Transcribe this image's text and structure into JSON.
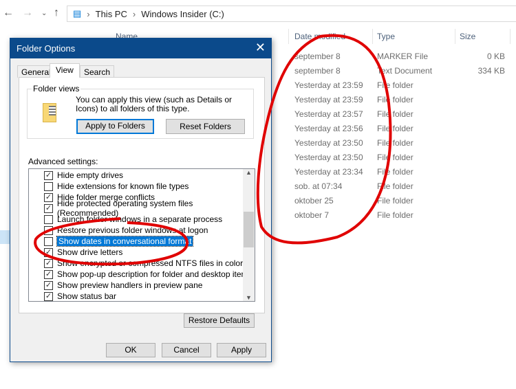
{
  "explorer": {
    "breadcrumb": [
      "This PC",
      "Windows Insider (C:)"
    ],
    "columns": [
      "Name",
      "Date modified",
      "Type",
      "Size"
    ],
    "rows": [
      {
        "date": "september 8",
        "type": "MARKER File",
        "size": "0 KB"
      },
      {
        "date": "september 8",
        "type": "Text Document",
        "size": "334 KB"
      },
      {
        "date": "Yesterday at 23:59",
        "type": "File folder",
        "size": ""
      },
      {
        "date": "Yesterday at 23:59",
        "type": "File folder",
        "size": ""
      },
      {
        "date": "Yesterday at 23:57",
        "type": "File folder",
        "size": ""
      },
      {
        "date": "Yesterday at 23:56",
        "type": "File folder",
        "size": ""
      },
      {
        "date": "Yesterday at 23:50",
        "type": "File folder",
        "size": ""
      },
      {
        "date": "Yesterday at 23:50",
        "type": "File folder",
        "size": ""
      },
      {
        "date": "Yesterday at 23:34",
        "type": "File folder",
        "size": ""
      },
      {
        "date": "sob. at 07:34",
        "type": "File folder",
        "size": ""
      },
      {
        "date": "oktober 25",
        "type": "File folder",
        "size": ""
      },
      {
        "date": "oktober 7",
        "type": "File folder",
        "size": ""
      }
    ]
  },
  "dialog": {
    "title": "Folder Options",
    "tabs": [
      "General",
      "View",
      "Search"
    ],
    "active_tab": "View",
    "folder_views_label": "Folder views",
    "folder_views_text": "You can apply this view (such as Details or Icons) to all folders of this type.",
    "apply_to_folders": "Apply to Folders",
    "reset_folders": "Reset Folders",
    "advanced_label": "Advanced settings:",
    "settings": [
      {
        "label": "Hide empty drives",
        "checked": true
      },
      {
        "label": "Hide extensions for known file types",
        "checked": false
      },
      {
        "label": "Hide folder merge conflicts",
        "checked": true
      },
      {
        "label": "Hide protected operating system files (Recommended)",
        "checked": true
      },
      {
        "label": "Launch folder windows in a separate process",
        "checked": false
      },
      {
        "label": "Restore previous folder windows at logon",
        "checked": false
      },
      {
        "label": "Show dates in conversational format",
        "checked": false,
        "selected": true
      },
      {
        "label": "Show drive letters",
        "checked": true
      },
      {
        "label": "Show encrypted or compressed NTFS files in color",
        "checked": true
      },
      {
        "label": "Show pop-up description for folder and desktop items",
        "checked": true
      },
      {
        "label": "Show preview handlers in preview pane",
        "checked": true
      },
      {
        "label": "Show status bar",
        "checked": true
      }
    ],
    "restore_defaults": "Restore Defaults",
    "ok": "OK",
    "cancel": "Cancel",
    "apply": "Apply"
  },
  "colors": {
    "title_bar": "#0b4a8b",
    "selection": "#0078d7",
    "annotation": "#e00000"
  }
}
